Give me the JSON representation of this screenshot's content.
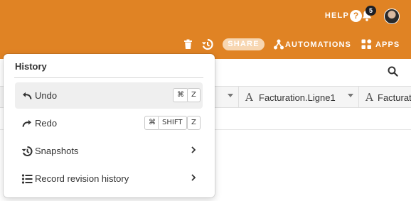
{
  "header": {
    "help_label": "HELP",
    "help_icon_glyph": "?",
    "notification_count": "5",
    "icons": [
      "help-icon",
      "bell-icon",
      "avatar"
    ],
    "accent_color": "#e08324"
  },
  "toolbar": {
    "share_label": "SHARE",
    "automations_label": "AUTOMATIONS",
    "apps_label": "APPS",
    "icons": [
      "trash-icon",
      "history-icon",
      "automations-icon",
      "apps-icon"
    ]
  },
  "grid": {
    "columns": [
      {
        "type_glyph": "A",
        "label": "Facturation.Ligne1"
      },
      {
        "type_glyph": "A",
        "label": "Facturati"
      }
    ]
  },
  "history_menu": {
    "title": "History",
    "items": [
      {
        "label": "Undo",
        "icon": "undo-icon",
        "shortcut": [
          "⌘",
          "Z"
        ],
        "active": true
      },
      {
        "label": "Redo",
        "icon": "redo-icon",
        "shortcut": [
          "⌘",
          "SHIFT",
          "Z"
        ],
        "active": false
      },
      {
        "label": "Snapshots",
        "icon": "snapshots-icon",
        "submenu": true
      },
      {
        "label": "Record revision history",
        "icon": "list-icon",
        "submenu": true
      }
    ]
  }
}
